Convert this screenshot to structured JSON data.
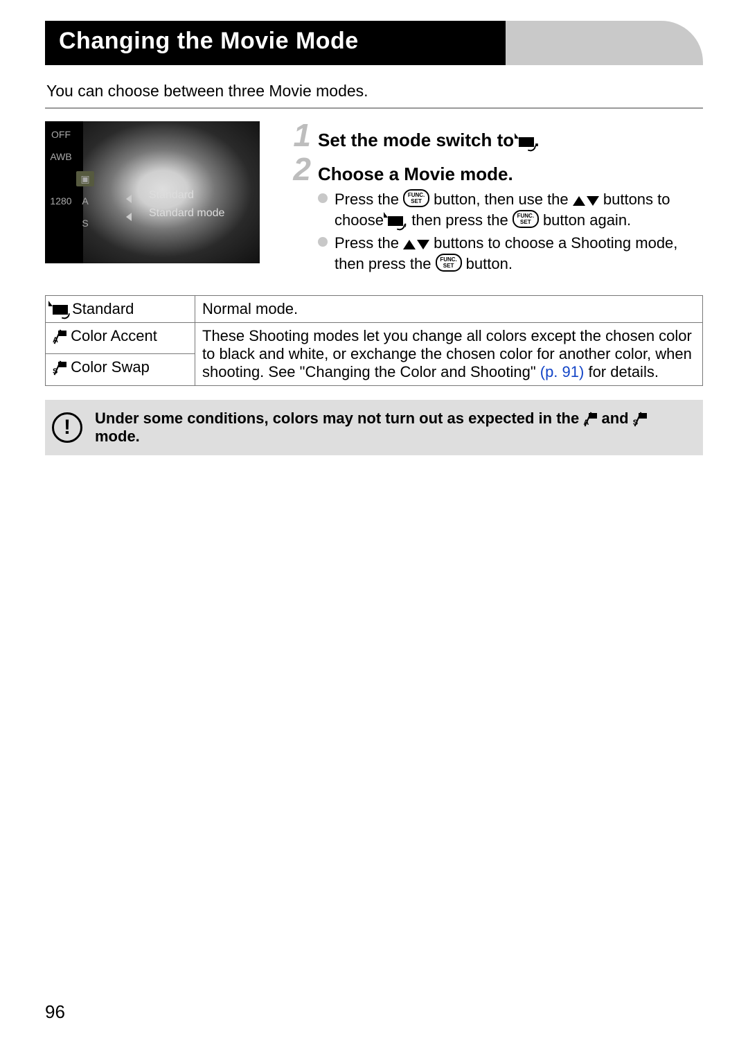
{
  "title": "Changing the Movie Mode",
  "intro": "You can choose between three Movie modes.",
  "lcd": {
    "label1": "Standard",
    "label2": "Standard mode",
    "left_icons": [
      "OFF",
      "AWB",
      "",
      "1280",
      ""
    ],
    "left2_icons": [
      "",
      "",
      "▣",
      "A",
      "S"
    ]
  },
  "steps": [
    {
      "num": "1",
      "title_pre": "Set the mode switch to ",
      "title_post": "."
    },
    {
      "num": "2",
      "title": "Choose a Movie mode.",
      "bullets": [
        {
          "seg1": "Press the ",
          "seg2": " button, then use the ",
          "seg3": " buttons to choose ",
          "seg4": ", then press the ",
          "seg5": " button again."
        },
        {
          "seg1": "Press the ",
          "seg2": " buttons to choose a Shooting mode, then press the ",
          "seg3": " button."
        }
      ]
    }
  ],
  "table": {
    "rows": [
      {
        "label": "Standard",
        "desc_full": "Normal mode."
      },
      {
        "label": "Color Accent"
      },
      {
        "label": "Color Swap"
      }
    ],
    "shared_desc_pre": "These Shooting modes let you change all colors except the chosen color to black and white, or exchange the chosen color for another color, when shooting. See \"Changing the Color and Shooting\" ",
    "shared_desc_link": "(p. 91)",
    "shared_desc_post": " for details."
  },
  "note": {
    "pre": "Under some conditions, colors may not turn out as expected in the ",
    "mid": " and ",
    "post": " mode."
  },
  "page_number": "96"
}
